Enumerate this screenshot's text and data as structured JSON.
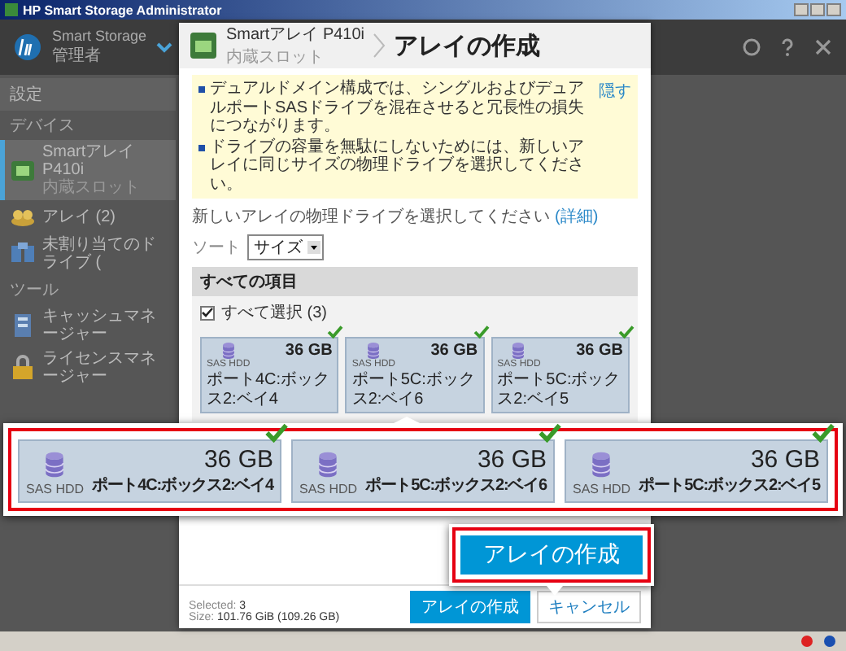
{
  "title_bar": {
    "title": "HP Smart Storage Administrator"
  },
  "app_header": {
    "title": "Smart Storage",
    "subtitle": "管理者"
  },
  "sidebar": {
    "items": [
      {
        "kind": "link",
        "label": "設定",
        "selected": false
      },
      {
        "kind": "section",
        "label": "デバイス"
      },
      {
        "kind": "item",
        "label": "Smartアレイ P410i",
        "sublabel": "内蔵スロット",
        "selected": true
      },
      {
        "kind": "item",
        "label": "アレイ (2)",
        "selected": false
      },
      {
        "kind": "item",
        "label": "未割り当てのドライブ (",
        "selected": false
      },
      {
        "kind": "section",
        "label": "ツール"
      },
      {
        "kind": "item",
        "label": "キャッシュマネージャー",
        "selected": false
      },
      {
        "kind": "item",
        "label": "ライセンスマネージャー",
        "selected": false
      }
    ]
  },
  "dialog": {
    "breadcrumb": {
      "title": "Smartアレイ P410i",
      "subtitle": "内蔵スロット"
    },
    "title": "アレイの作成",
    "notice": {
      "lines": [
        "デュアルドメイン構成では、シングルおよびデュアルポートSASドライブを混在させると冗長性の損失につながります。",
        "ドライブの容量を無駄にしないためには、新しいアレイに同じサイズの物理ドライブを選択してください。"
      ],
      "link": "隠す"
    },
    "prompt": "新しいアレイの物理ドライブを選択してください",
    "prompt_link": "(詳細)",
    "sort": {
      "label": "ソート",
      "value": "サイズ"
    },
    "group": {
      "title": "すべての項目",
      "select_all": {
        "label": "すべて選択 (3)",
        "checked": true
      },
      "drives": [
        {
          "capacity": "36 GB",
          "type": "SAS HDD",
          "location": "ポート4C:ボックス2:ベイ4",
          "checked": true
        },
        {
          "capacity": "36 GB",
          "type": "SAS HDD",
          "location": "ポート5C:ボックス2:ベイ6",
          "checked": true
        },
        {
          "capacity": "36 GB",
          "type": "SAS HDD",
          "location": "ポート5C:ボックス2:ベイ5",
          "checked": true
        }
      ]
    },
    "footer": {
      "selected_label": "Selected:",
      "selected_value": "3",
      "size_label": "Size:",
      "size_value": "101.76 GiB (109.26 GB)"
    },
    "buttons": [
      {
        "label": "アレイの作成",
        "kind": "primary"
      },
      {
        "label": "キャンセル",
        "kind": "secondary"
      }
    ]
  },
  "zoom_callout": {
    "drives": [
      {
        "capacity": "36 GB",
        "type": "SAS HDD",
        "location": "ポート4C:ボックス2:ベイ4",
        "checked": true
      },
      {
        "capacity": "36 GB",
        "type": "SAS HDD",
        "location": "ポート5C:ボックス2:ベイ6",
        "checked": true
      },
      {
        "capacity": "36 GB",
        "type": "SAS HDD",
        "location": "ポート5C:ボックス2:ベイ5",
        "checked": true
      }
    ]
  },
  "button_callout": {
    "label": "アレイの作成"
  }
}
